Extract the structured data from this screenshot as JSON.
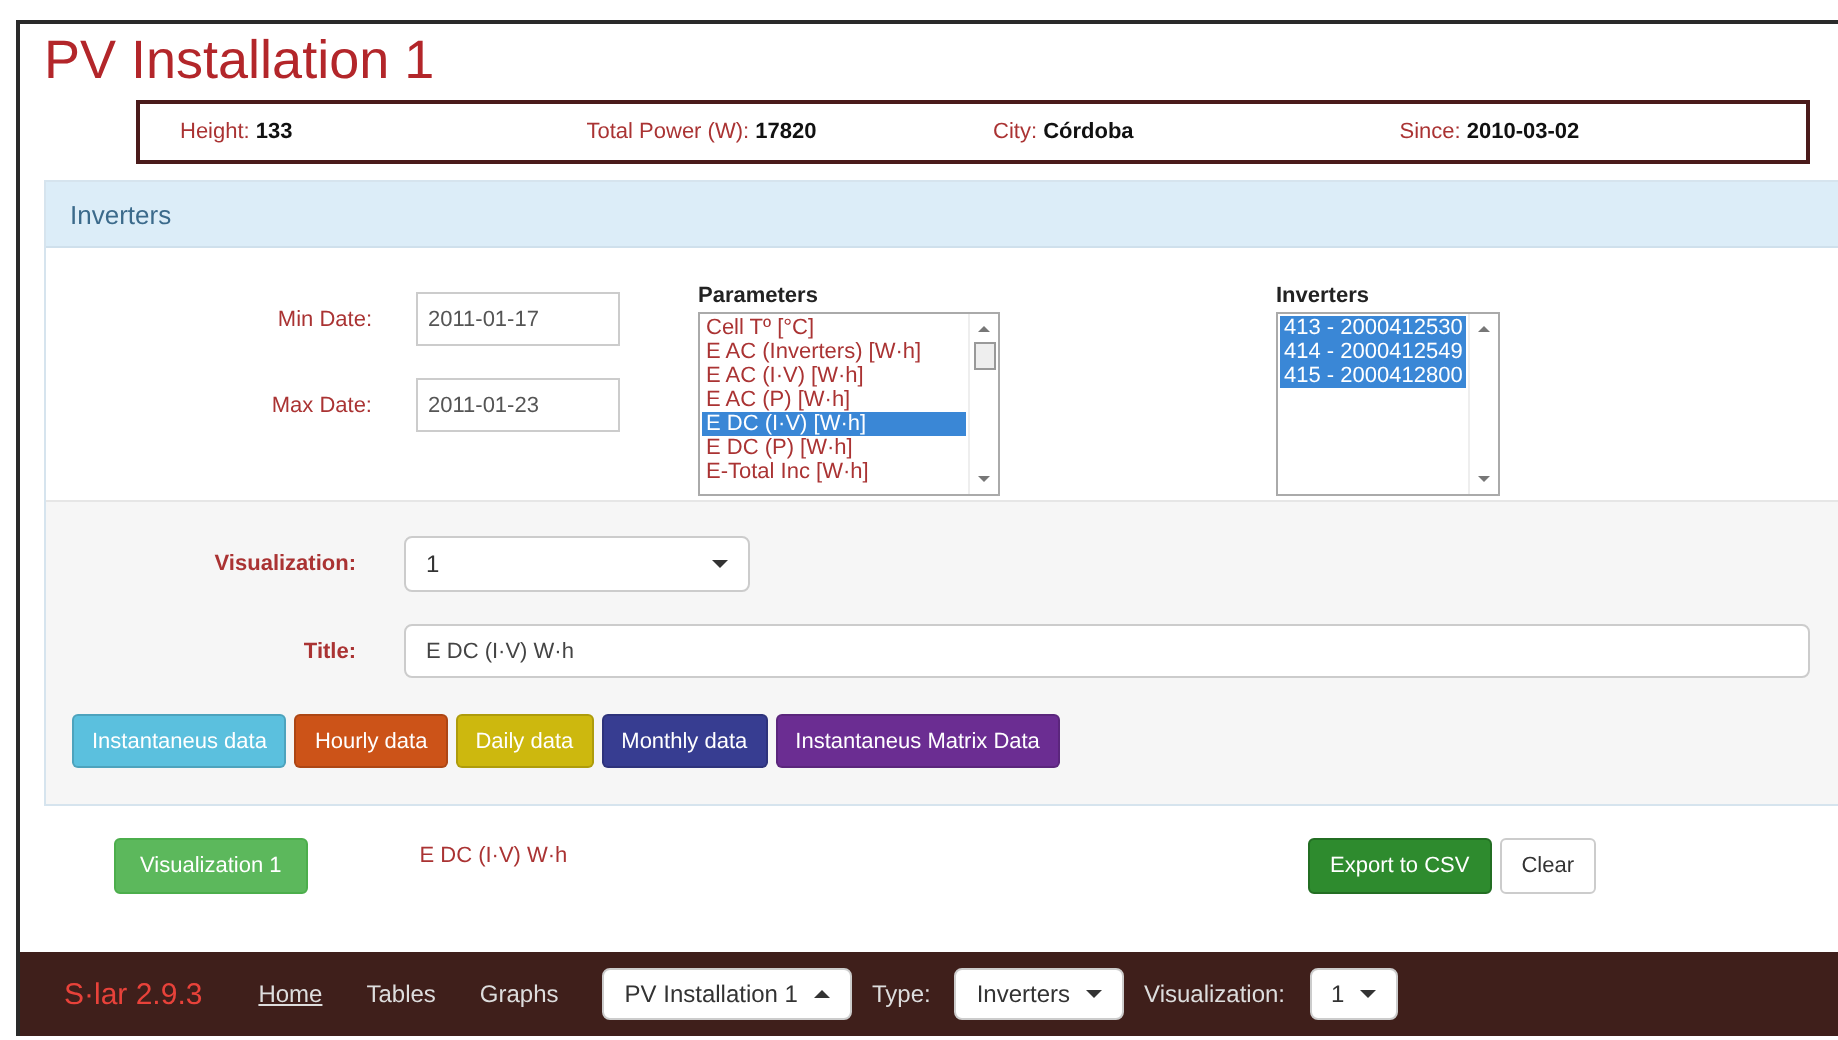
{
  "title": "PV Installation 1",
  "summary": [
    {
      "label": "Height:",
      "value": "133"
    },
    {
      "label": "Total Power (W):",
      "value": "17820"
    },
    {
      "label": "City:",
      "value": "Córdoba"
    },
    {
      "label": "Since:",
      "value": "2010-03-02"
    }
  ],
  "panel": {
    "heading": "Inverters",
    "min_date": {
      "label": "Min Date:",
      "value": "2011-01-17"
    },
    "max_date": {
      "label": "Max Date:",
      "value": "2011-01-23"
    },
    "parameters": {
      "label": "Parameters",
      "options": [
        {
          "text": "Cell Tº [°C]",
          "selected": false
        },
        {
          "text": "E AC (Inverters) [W·h]",
          "selected": false
        },
        {
          "text": "E AC (I·V) [W·h]",
          "selected": false
        },
        {
          "text": "E AC (P) [W·h]",
          "selected": false
        },
        {
          "text": "E DC (I·V) [W·h]",
          "selected": true
        },
        {
          "text": "E DC (P) [W·h]",
          "selected": false
        },
        {
          "text": "E-Total Inc [W·h]",
          "selected": false
        }
      ]
    },
    "inverters": {
      "label": "Inverters",
      "options": [
        {
          "text": "413 - 2000412530",
          "selected": true
        },
        {
          "text": "414 - 2000412549",
          "selected": true
        },
        {
          "text": "415 - 2000412800",
          "selected": true
        }
      ]
    },
    "visualization": {
      "label": "Visualization:",
      "value": "1"
    },
    "title_field": {
      "label": "Title:",
      "value": "E DC (I·V) W·h"
    },
    "data_buttons": [
      {
        "label": "Instantaneus data",
        "color": "#5bc0de"
      },
      {
        "label": "Hourly data",
        "color": "#cc5318"
      },
      {
        "label": "Daily data",
        "color": "#cdb80e"
      },
      {
        "label": "Monthly data",
        "color": "#373d91"
      },
      {
        "label": "Instantaneus Matrix Data",
        "color": "#6b2d92"
      }
    ]
  },
  "visualization_button": "Visualization 1",
  "visualization_title": "E DC (I·V) W·h",
  "export_button": "Export to CSV",
  "clear_button": "Clear",
  "navbar": {
    "brand": "S·lar 2.9.3",
    "links": [
      {
        "label": "Home",
        "selected": true
      },
      {
        "label": "Tables",
        "selected": false
      },
      {
        "label": "Graphs",
        "selected": false
      }
    ],
    "installation": {
      "value": "PV Installation 1",
      "expanded": true
    },
    "type_label": "Type:",
    "type": {
      "value": "Inverters",
      "expanded": false
    },
    "visualization_label": "Visualization:",
    "visualization": {
      "value": "1",
      "expanded": false
    }
  }
}
